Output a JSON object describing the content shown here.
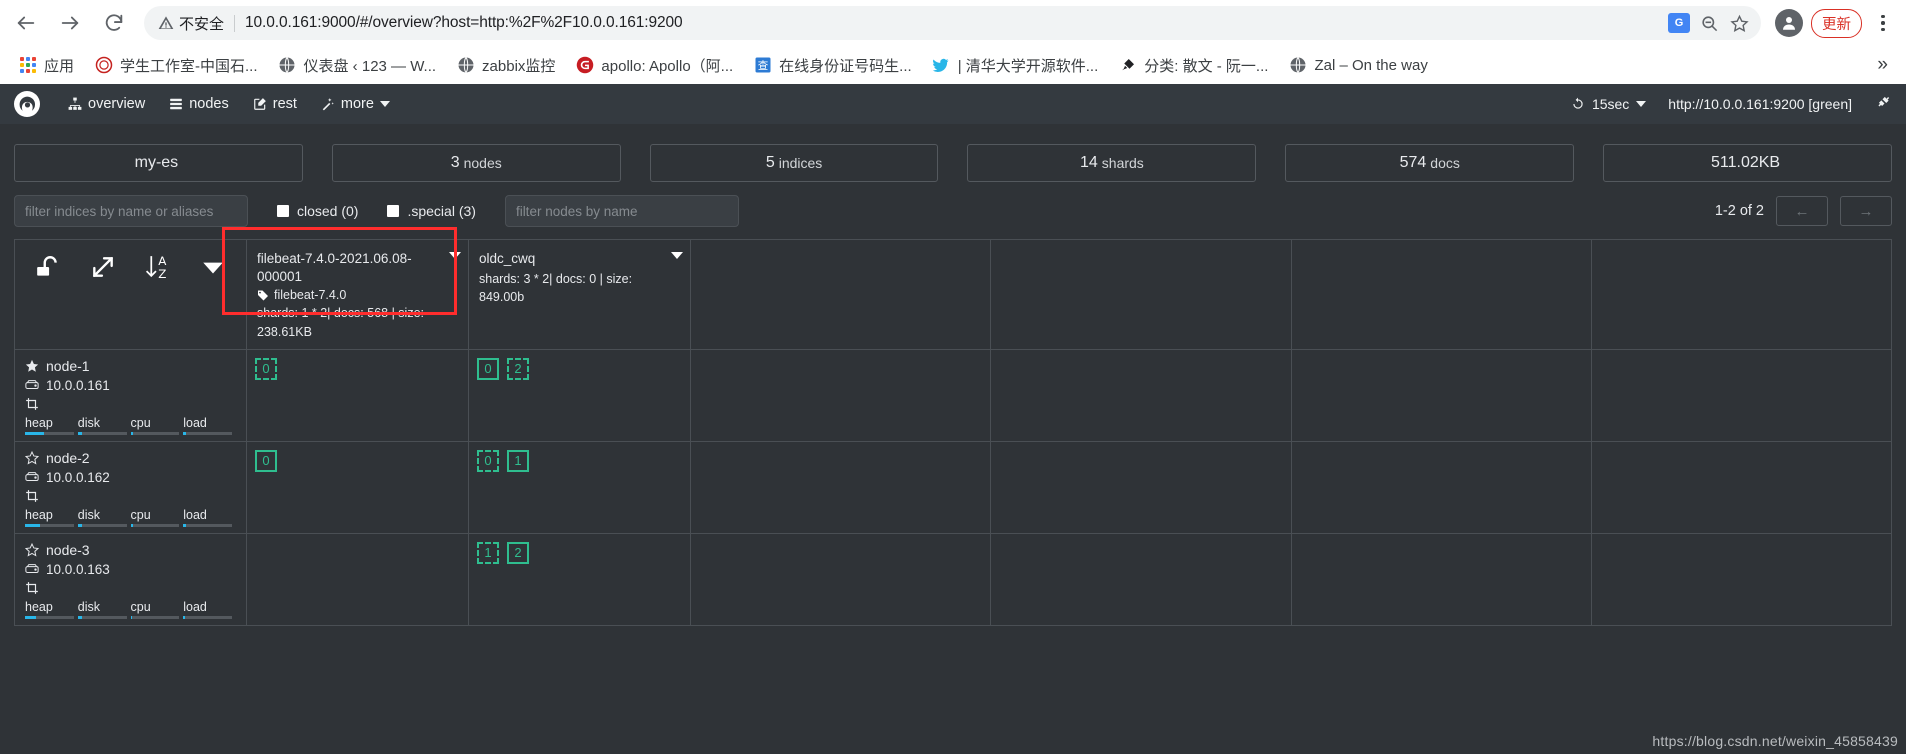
{
  "browser": {
    "back_icon": "back-arrow-icon",
    "forward_icon": "forward-arrow-icon",
    "reload_icon": "reload-icon",
    "insecure_label": "不安全",
    "url": "10.0.0.161:9000/#/overview?host=http:%2F%2F10.0.0.161:9200",
    "translate_label": "G",
    "update_label": "更新",
    "bookmarks": [
      {
        "label": "应用",
        "icon": "apps-grid-icon"
      },
      {
        "label": "学生工作室-中国石...",
        "icon": "site-icon-cup"
      },
      {
        "label": "仪表盘 ‹ 123 — W...",
        "icon": "globe-icon"
      },
      {
        "label": "zabbix监控",
        "icon": "globe-icon"
      },
      {
        "label": "apollo: Apollo（阿...",
        "icon": "gitee-icon"
      },
      {
        "label": "在线身份证号码生...",
        "icon": "cha-icon"
      },
      {
        "label": "| 清华大学开源软件...",
        "icon": "bird-icon"
      },
      {
        "label": "分类: 散文 - 阮一...",
        "icon": "brush-icon"
      },
      {
        "label": "Zal – On the way",
        "icon": "globe-icon"
      }
    ],
    "overflow_label": "»"
  },
  "navbar": {
    "brand_icon": "cerebro-logo-icon",
    "links": [
      {
        "label": "overview",
        "icon": "sitemap-icon"
      },
      {
        "label": "nodes",
        "icon": "server-list-icon"
      },
      {
        "label": "rest",
        "icon": "edit-square-icon"
      },
      {
        "label": "more",
        "icon": "magic-wand-icon",
        "has_caret": true
      }
    ],
    "refresh_interval": "15sec",
    "refresh_icon": "refresh-icon",
    "host_status": "http://10.0.0.161:9200 [green]",
    "plug_icon": "plug-disconnect-icon"
  },
  "stats": [
    {
      "num": "my-es",
      "unit": ""
    },
    {
      "num": "3",
      "unit": "nodes"
    },
    {
      "num": "5",
      "unit": "indices"
    },
    {
      "num": "14",
      "unit": "shards"
    },
    {
      "num": "574",
      "unit": "docs"
    },
    {
      "num": "511.02KB",
      "unit": ""
    }
  ],
  "filters": {
    "indices_placeholder": "filter indices by name or aliases",
    "indices_value": "",
    "closed_label": "closed (0)",
    "special_label": ".special (3)",
    "nodes_placeholder": "filter nodes by name",
    "nodes_value": "",
    "page_count": "1-2 of 2",
    "prev_label": "←",
    "next_label": "→"
  },
  "grid_toolbar": {
    "lock_icon": "unlock-icon",
    "expand_icon": "expand-arrows-icon",
    "sort_icon": "sort-alpha-asc-icon",
    "caret_icon": "chevron-down-icon"
  },
  "indices": [
    {
      "name": "filebeat-7.4.0-2021.06.08-000001",
      "alias": "filebeat-7.4.0",
      "alias_icon": "tag-icon",
      "meta": "shards: 1 * 2| docs: 568 | size: 238.61KB",
      "highlighted": true
    },
    {
      "name": "oldc_cwq",
      "alias": "",
      "alias_icon": "",
      "meta": "shards: 3 * 2| docs: 0 | size: 849.00b",
      "highlighted": false
    }
  ],
  "nodes": [
    {
      "name": "node-1",
      "ip": "10.0.0.161",
      "master": true,
      "star_icon": "star-filled-icon",
      "server_icon": "hdd-icon",
      "role_icon": "crop-icon",
      "metrics": [
        {
          "label": "heap",
          "pct": 38
        },
        {
          "label": "disk",
          "pct": 5
        },
        {
          "label": "cpu",
          "pct": 3
        },
        {
          "label": "load",
          "pct": 3
        }
      ],
      "shards": {
        "filebeat-7.4.0-2021.06.08-000001": [
          {
            "value": "0",
            "type": "replica"
          }
        ],
        "oldc_cwq": [
          {
            "value": "0",
            "type": "primary"
          },
          {
            "value": "2",
            "type": "replica"
          }
        ]
      }
    },
    {
      "name": "node-2",
      "ip": "10.0.0.162",
      "master": false,
      "star_icon": "star-outline-icon",
      "server_icon": "hdd-icon",
      "role_icon": "crop-icon",
      "metrics": [
        {
          "label": "heap",
          "pct": 30
        },
        {
          "label": "disk",
          "pct": 5
        },
        {
          "label": "cpu",
          "pct": 3
        },
        {
          "label": "load",
          "pct": 3
        }
      ],
      "shards": {
        "filebeat-7.4.0-2021.06.08-000001": [
          {
            "value": "0",
            "type": "primary"
          }
        ],
        "oldc_cwq": [
          {
            "value": "0",
            "type": "replica"
          },
          {
            "value": "1",
            "type": "primary"
          }
        ]
      }
    },
    {
      "name": "node-3",
      "ip": "10.0.0.163",
      "master": false,
      "star_icon": "star-outline-icon",
      "server_icon": "hdd-icon",
      "role_icon": "crop-icon",
      "metrics": [
        {
          "label": "heap",
          "pct": 22
        },
        {
          "label": "disk",
          "pct": 5
        },
        {
          "label": "cpu",
          "pct": 2
        },
        {
          "label": "load",
          "pct": 2
        }
      ],
      "shards": {
        "filebeat-7.4.0-2021.06.08-000001": [],
        "oldc_cwq": [
          {
            "value": "1",
            "type": "replica"
          },
          {
            "value": "2",
            "type": "primary"
          }
        ]
      }
    }
  ],
  "watermark": "https://blog.csdn.net/weixin_45858439",
  "colors": {
    "accent_green": "#2fbe8f",
    "metric_blue": "#29b6e8",
    "highlight_red": "#ff2d2d",
    "bg": "#2f3337",
    "navbar_bg": "#343a40"
  }
}
